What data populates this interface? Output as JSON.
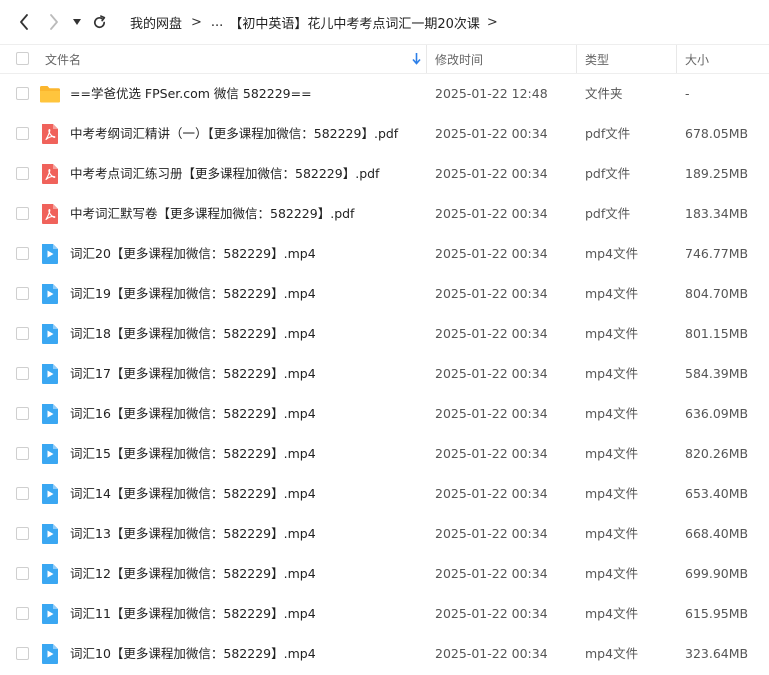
{
  "breadcrumb": {
    "root": "我的网盘",
    "ellipsis": "...",
    "current": "【初中英语】花儿中考考点词汇一期20次课"
  },
  "table": {
    "columns": {
      "name": "文件名",
      "mtime": "修改时间",
      "type": "类型",
      "size": "大小"
    },
    "rows": [
      {
        "icon": "folder-icon",
        "name": "==学爸优选 FPSer.com 微信 582229==",
        "mtime": "2025-01-22 12:48",
        "type": "文件夹",
        "size": "-"
      },
      {
        "icon": "pdf-icon",
        "name": "中考考纲词汇精讲（一）【更多课程加微信：582229】.pdf",
        "mtime": "2025-01-22 00:34",
        "type": "pdf文件",
        "size": "678.05MB"
      },
      {
        "icon": "pdf-icon",
        "name": "中考考点词汇练习册【更多课程加微信：582229】.pdf",
        "mtime": "2025-01-22 00:34",
        "type": "pdf文件",
        "size": "189.25MB"
      },
      {
        "icon": "pdf-icon",
        "name": "中考词汇默写卷【更多课程加微信：582229】.pdf",
        "mtime": "2025-01-22 00:34",
        "type": "pdf文件",
        "size": "183.34MB"
      },
      {
        "icon": "video-icon",
        "name": "词汇20【更多课程加微信：582229】.mp4",
        "mtime": "2025-01-22 00:34",
        "type": "mp4文件",
        "size": "746.77MB"
      },
      {
        "icon": "video-icon",
        "name": "词汇19【更多课程加微信：582229】.mp4",
        "mtime": "2025-01-22 00:34",
        "type": "mp4文件",
        "size": "804.70MB"
      },
      {
        "icon": "video-icon",
        "name": "词汇18【更多课程加微信：582229】.mp4",
        "mtime": "2025-01-22 00:34",
        "type": "mp4文件",
        "size": "801.15MB"
      },
      {
        "icon": "video-icon",
        "name": "词汇17【更多课程加微信：582229】.mp4",
        "mtime": "2025-01-22 00:34",
        "type": "mp4文件",
        "size": "584.39MB"
      },
      {
        "icon": "video-icon",
        "name": "词汇16【更多课程加微信：582229】.mp4",
        "mtime": "2025-01-22 00:34",
        "type": "mp4文件",
        "size": "636.09MB"
      },
      {
        "icon": "video-icon",
        "name": "词汇15【更多课程加微信：582229】.mp4",
        "mtime": "2025-01-22 00:34",
        "type": "mp4文件",
        "size": "820.26MB"
      },
      {
        "icon": "video-icon",
        "name": "词汇14【更多课程加微信：582229】.mp4",
        "mtime": "2025-01-22 00:34",
        "type": "mp4文件",
        "size": "653.40MB"
      },
      {
        "icon": "video-icon",
        "name": "词汇13【更多课程加微信：582229】.mp4",
        "mtime": "2025-01-22 00:34",
        "type": "mp4文件",
        "size": "668.40MB"
      },
      {
        "icon": "video-icon",
        "name": "词汇12【更多课程加微信：582229】.mp4",
        "mtime": "2025-01-22 00:34",
        "type": "mp4文件",
        "size": "699.90MB"
      },
      {
        "icon": "video-icon",
        "name": "词汇11【更多课程加微信：582229】.mp4",
        "mtime": "2025-01-22 00:34",
        "type": "mp4文件",
        "size": "615.95MB"
      },
      {
        "icon": "video-icon",
        "name": "词汇10【更多课程加微信：582229】.mp4",
        "mtime": "2025-01-22 00:34",
        "type": "mp4文件",
        "size": "323.64MB"
      }
    ]
  },
  "colors": {
    "folder": "#FBB62E",
    "pdf": "#F0625B",
    "video": "#3AA7F2",
    "sort_arrow": "#2C7FE8"
  }
}
